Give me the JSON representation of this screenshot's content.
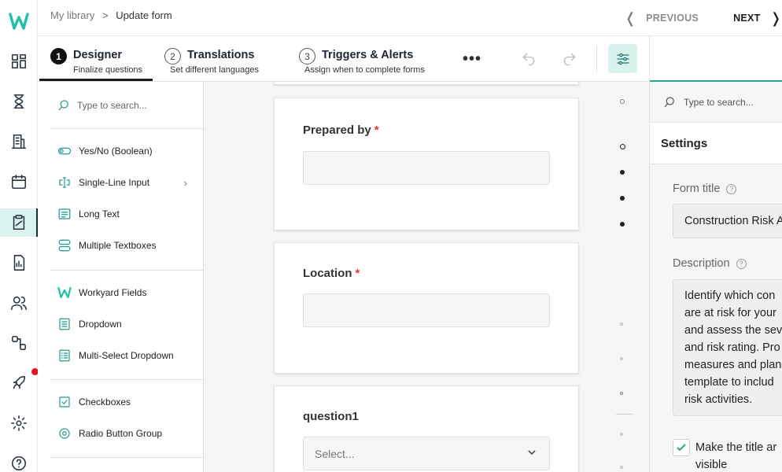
{
  "brand": {
    "logo_letter": "W",
    "accent": "#1ea88f",
    "required_color": "#e0323c"
  },
  "rail": {
    "items": [
      "dashboard-icon",
      "hourglass-icon",
      "building-icon",
      "calendar-icon",
      "clipboard-icon",
      "report-icon",
      "users-icon",
      "workflow-icon",
      "rocket-icon",
      "gear-icon",
      "help-icon"
    ],
    "active": "clipboard-icon",
    "notification_color": "#e8141c"
  },
  "breadcrumb": {
    "root": "My library",
    "current": "Update form"
  },
  "nav": {
    "previous": "PREVIOUS",
    "next": "NEXT"
  },
  "steps": [
    {
      "num": "1",
      "title": "Designer",
      "subtitle": "Finalize questions",
      "active": true
    },
    {
      "num": "2",
      "title": "Translations",
      "subtitle": "Set different languages"
    },
    {
      "num": "3",
      "title": "Triggers & Alerts",
      "subtitle": "Assign when to complete forms"
    }
  ],
  "more_label": "•••",
  "palette": {
    "search_placeholder": "Type to search...",
    "items": [
      {
        "label": "Yes/No (Boolean)",
        "icon": "toggle-icon"
      },
      {
        "label": "Single-Line Input",
        "icon": "text-cursor-icon",
        "has_submenu": true
      },
      {
        "label": "Long Text",
        "icon": "paragraph-icon"
      },
      {
        "label": "Multiple Textboxes",
        "icon": "stacked-fields-icon"
      },
      {
        "label": "Workyard Fields",
        "icon": "workyard-icon"
      },
      {
        "label": "Dropdown",
        "icon": "dropdown-icon"
      },
      {
        "label": "Multi-Select Dropdown",
        "icon": "multi-select-icon"
      },
      {
        "label": "Checkboxes",
        "icon": "checkbox-icon"
      },
      {
        "label": "Radio Button Group",
        "icon": "radio-icon"
      }
    ]
  },
  "questions": [
    {
      "label": "Prepared by",
      "required": true,
      "type": "text"
    },
    {
      "label": "Location",
      "required": true,
      "type": "text"
    },
    {
      "label": "question1",
      "required": false,
      "type": "dropdown",
      "placeholder": "Select..."
    }
  ],
  "settings": {
    "search_placeholder": "Type to search...",
    "heading": "Settings",
    "form_title_label": "Form title",
    "form_title_value": "Construction Risk A",
    "description_label": "Description",
    "description_lines": [
      "Identify which con",
      "are at risk for your",
      "and assess the sev",
      "and risk rating. Pro",
      "measures and plan",
      "template to includ",
      "risk activities."
    ],
    "checkbox_label": "Make the title and visible",
    "checkbox_label_line1": "Make the title ar",
    "checkbox_label_line2": "visible",
    "checkbox_checked": true
  }
}
